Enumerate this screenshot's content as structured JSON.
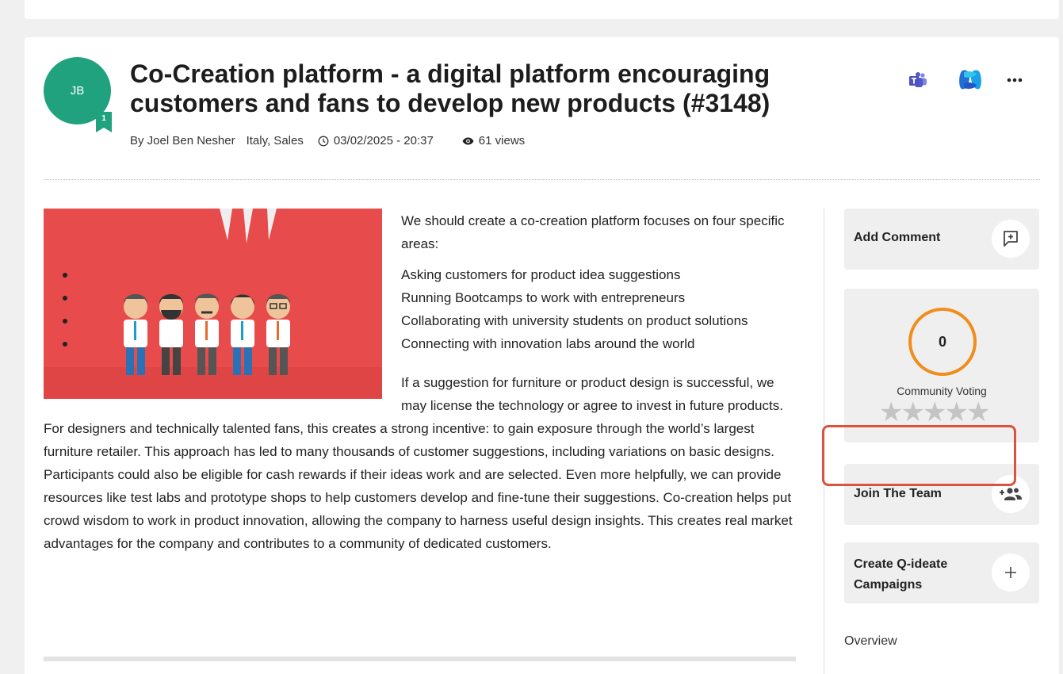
{
  "idea": {
    "avatar_initials": "JB",
    "badge_level": "1",
    "title": "Co-Creation platform - a digital platform encouraging customers and fans to develop new products (#3148)",
    "author": "By Joel Ben Nesher",
    "location": "Italy, Sales",
    "datetime": "03/02/2025 - 20:37",
    "views": "61 views"
  },
  "header_icons": [
    "teams-icon",
    "copilot-icon",
    "more-options-icon"
  ],
  "body": {
    "intro": "We should create a co-creation platform focuses on four specific areas:",
    "bullets": [
      "Asking customers for product idea suggestions",
      "Running Bootcamps to work with entrepreneurs",
      "Collaborating with university students on product solutions",
      "Connecting with innovation labs around the world"
    ],
    "paragraph": "If a suggestion for furniture or product design is successful, we may license the technology or agree to invest in future products. For designers and technically talented fans, this creates a strong incentive: to gain exposure through the world’s largest furniture retailer. This approach has led to many thousands of customer suggestions, including variations on basic designs. Participants could also be eligible for cash rewards if their ideas work and are selected. Even more helpfully, we can provide resources like test labs and prototype shops to help customers develop and fine-tune their suggestions. Co-creation helps put crowd wisdom to work in product innovation, allowing the company to harness useful design insights. This creates real market advantages for the company and contributes to a community of dedicated customers."
  },
  "sidebar": {
    "add_comment": "Add Comment",
    "voting_score": "0",
    "voting_label": "Community Voting",
    "star_rating": 0,
    "join_team": "Join The Team",
    "create_campaigns": "Create Q-ideate Campaigns",
    "overview": "Overview"
  },
  "colors": {
    "avatar": "#21a27e",
    "voting_ring": "#f08d1b",
    "highlight": "#d9533f",
    "hero_bg": "#e84b4b"
  }
}
